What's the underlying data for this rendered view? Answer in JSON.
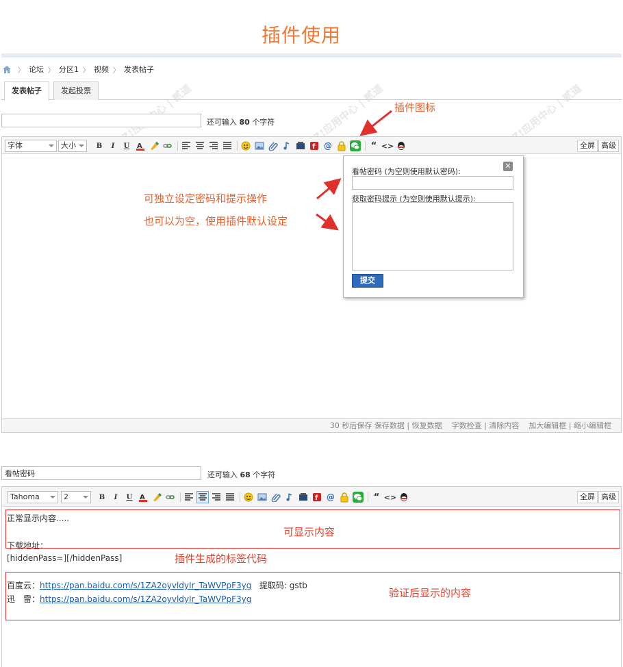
{
  "page_title": "插件使用",
  "breadcrumb": [
    "论坛",
    "分区1",
    "视频",
    "发表帖子"
  ],
  "tabs": [
    "发表帖子",
    "发起投票"
  ],
  "editor1": {
    "title_value": "",
    "chars_prefix": "还可输入",
    "chars_count": "80",
    "chars_suffix": "个字符",
    "font_select": "字体",
    "size_select": "大小",
    "fullscreen": "全屏",
    "advanced": "高级",
    "status": {
      "autosave": "30 秒后保存",
      "save": "保存数据",
      "restore": "恢复数据",
      "count": "字数检查",
      "clear": "清除内容",
      "enlarge": "加大编辑框",
      "shrink": "缩小编辑框"
    }
  },
  "popup": {
    "password_label": "看帖密码 (为空则使用默认密码):",
    "hint_label": "获取密码提示 (为空则使用默认提示):",
    "submit": "提交",
    "close": "✕"
  },
  "annotations": {
    "plugin_icon": "插件图标",
    "set_pass_1": "可独立设定密码和提示操作",
    "set_pass_2": "也可以为空，使用插件默认设定",
    "visible_content": "可显示内容",
    "tag_code": "插件生成的标签代码",
    "hidden_content": "验证后显示的内容"
  },
  "editor2": {
    "title_value": "看帖密码",
    "chars_prefix": "还可输入",
    "chars_count": "68",
    "chars_suffix": "个字符",
    "font_select": "Tahoma",
    "size_select": "2",
    "fullscreen": "全屏",
    "advanced": "高级",
    "line1": "正常显示内容.....",
    "line2": "下载地址：",
    "line3": "[hiddenPass=][/hiddenPass]",
    "baidu_label": "百度云：",
    "baidu_link": "https://pan.baidu.com/s/1ZA2oyvldyIr_TaWVPpF3yg",
    "code_label": "提取码: gstb",
    "xunlei_label": "迅　雷：",
    "xunlei_link": "https://pan.baidu.com/s/1ZA2oyvldyIr_TaWVPpF3yg"
  },
  "colors": {
    "annotation": "#e8602c",
    "box": "#e0302c",
    "link": "#1a5bb5"
  }
}
